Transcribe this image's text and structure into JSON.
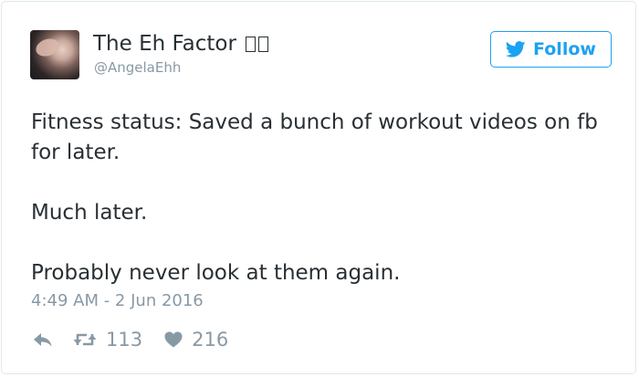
{
  "tweet": {
    "author": {
      "display_name": "The Eh Factor",
      "handle": "@AngelaEhh"
    },
    "follow_button": {
      "label": "Follow",
      "icon": "twitter-bird-icon"
    },
    "text": [
      "Fitness status: Saved a bunch of workout videos on fb for later.",
      "Much later.",
      "Probably never look at them again."
    ],
    "timestamp": "4:49 AM - 2 Jun 2016",
    "actions": {
      "reply": {
        "icon": "reply-icon"
      },
      "retweet": {
        "icon": "retweet-icon",
        "count": "113"
      },
      "like": {
        "icon": "heart-icon",
        "count": "216"
      }
    }
  },
  "colors": {
    "accent": "#1da1f2",
    "text": "#292f33",
    "muted": "#8899a6",
    "border": "#e1e8ed"
  }
}
